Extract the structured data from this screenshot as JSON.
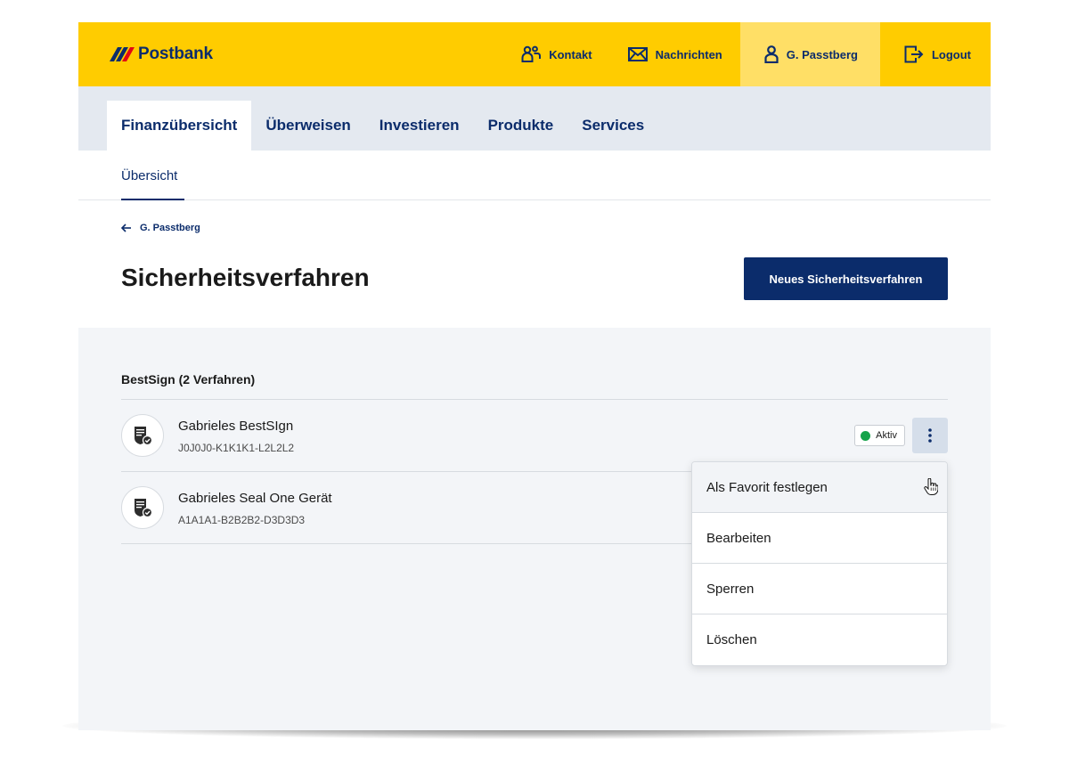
{
  "brand": {
    "name": "Postbank"
  },
  "topbar": {
    "items": [
      {
        "label": "Kontakt",
        "icon": "contact-icon"
      },
      {
        "label": "Nachrichten",
        "icon": "mail-icon"
      },
      {
        "label": "G. Passtberg",
        "icon": "user-icon"
      },
      {
        "label": "Logout",
        "icon": "logout-icon"
      }
    ]
  },
  "mainnav": {
    "tabs": [
      {
        "label": "Finanzübersicht"
      },
      {
        "label": "Überweisen"
      },
      {
        "label": "Investieren"
      },
      {
        "label": "Produkte"
      },
      {
        "label": "Services"
      }
    ]
  },
  "subnav": {
    "active": "Übersicht"
  },
  "page": {
    "back_label": "G. Passtberg",
    "title": "Sicherheitsverfahren",
    "new_button": "Neues Sicherheitsverfahren"
  },
  "group": {
    "title": "BestSign (2 Verfahren)",
    "items": [
      {
        "name": "Gabrieles BestSIgn",
        "code": "J0J0J0-K1K1K1-L2L2L2",
        "status": "Aktiv"
      },
      {
        "name": "Gabrieles Seal One Gerät",
        "code": "A1A1A1-B2B2B2-D3D3D3"
      }
    ]
  },
  "menu": {
    "items": [
      {
        "label": "Als Favorit festlegen"
      },
      {
        "label": "Bearbeiten"
      },
      {
        "label": "Sperren"
      },
      {
        "label": "Löschen"
      }
    ]
  },
  "colors": {
    "brand_yellow": "#ffcc00",
    "brand_blue": "#0b2c6b",
    "status_green": "#16a34a"
  }
}
